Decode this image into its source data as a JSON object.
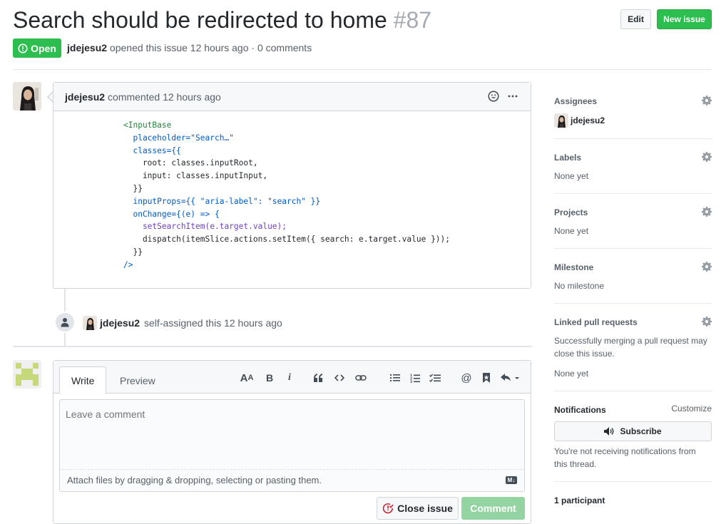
{
  "issue": {
    "title": "Search should be redirected to home",
    "number": "#87",
    "state": "Open",
    "author": "jdejesu2",
    "meta_text": "opened this issue 12 hours ago · 0 comments"
  },
  "header": {
    "edit_label": "Edit",
    "new_issue_label": "New issue"
  },
  "comment": {
    "author": "jdejesu2",
    "time": "commented 12 hours ago",
    "code_lines": [
      "<InputBase",
      "  placeholder=\"Search…\"",
      "  classes={{",
      "    root: classes.inputRoot,",
      "    input: classes.inputInput,",
      "  }}",
      "  inputProps={{ \"aria-label\": \"search\" }}",
      "  onChange={(e) => {",
      "    setSearchItem(e.target.value);",
      "    dispatch(itemSlice.actions.setItem({ search: e.target.value }));",
      "  }}",
      "/>"
    ]
  },
  "event": {
    "author": "jdejesu2",
    "text": "self-assigned this 12 hours ago"
  },
  "form": {
    "tab_write": "Write",
    "tab_preview": "Preview",
    "placeholder": "Leave a comment",
    "attach_text": "Attach files by dragging & dropping, selecting or pasting them.",
    "md_badge": "M↓",
    "close_label": "Close issue",
    "comment_label": "Comment",
    "toolbar": [
      "header-icon",
      "bold-icon",
      "italic-icon",
      "quote-icon",
      "code-icon",
      "link-icon",
      "bulleted-list-icon",
      "numbered-list-icon",
      "task-list-icon",
      "mention-icon",
      "reference-icon",
      "reply-icon"
    ]
  },
  "sidebar": {
    "assignees": {
      "title": "Assignees",
      "user": "jdejesu2"
    },
    "labels": {
      "title": "Labels",
      "value": "None yet"
    },
    "projects": {
      "title": "Projects",
      "value": "None yet"
    },
    "milestone": {
      "title": "Milestone",
      "value": "No milestone"
    },
    "linked": {
      "title": "Linked pull requests",
      "desc": "Successfully merging a pull request may close this issue.",
      "value": "None yet"
    },
    "notifications": {
      "title": "Notifications",
      "customize": "Customize",
      "subscribe": "Subscribe",
      "desc": "You're not receiving notifications from this thread."
    },
    "participants": {
      "title": "1 participant"
    }
  },
  "colors": {
    "green": "#2cbe4e",
    "green_disabled": "#94d3a2",
    "border": "#d1d5da",
    "muted": "#586069"
  }
}
